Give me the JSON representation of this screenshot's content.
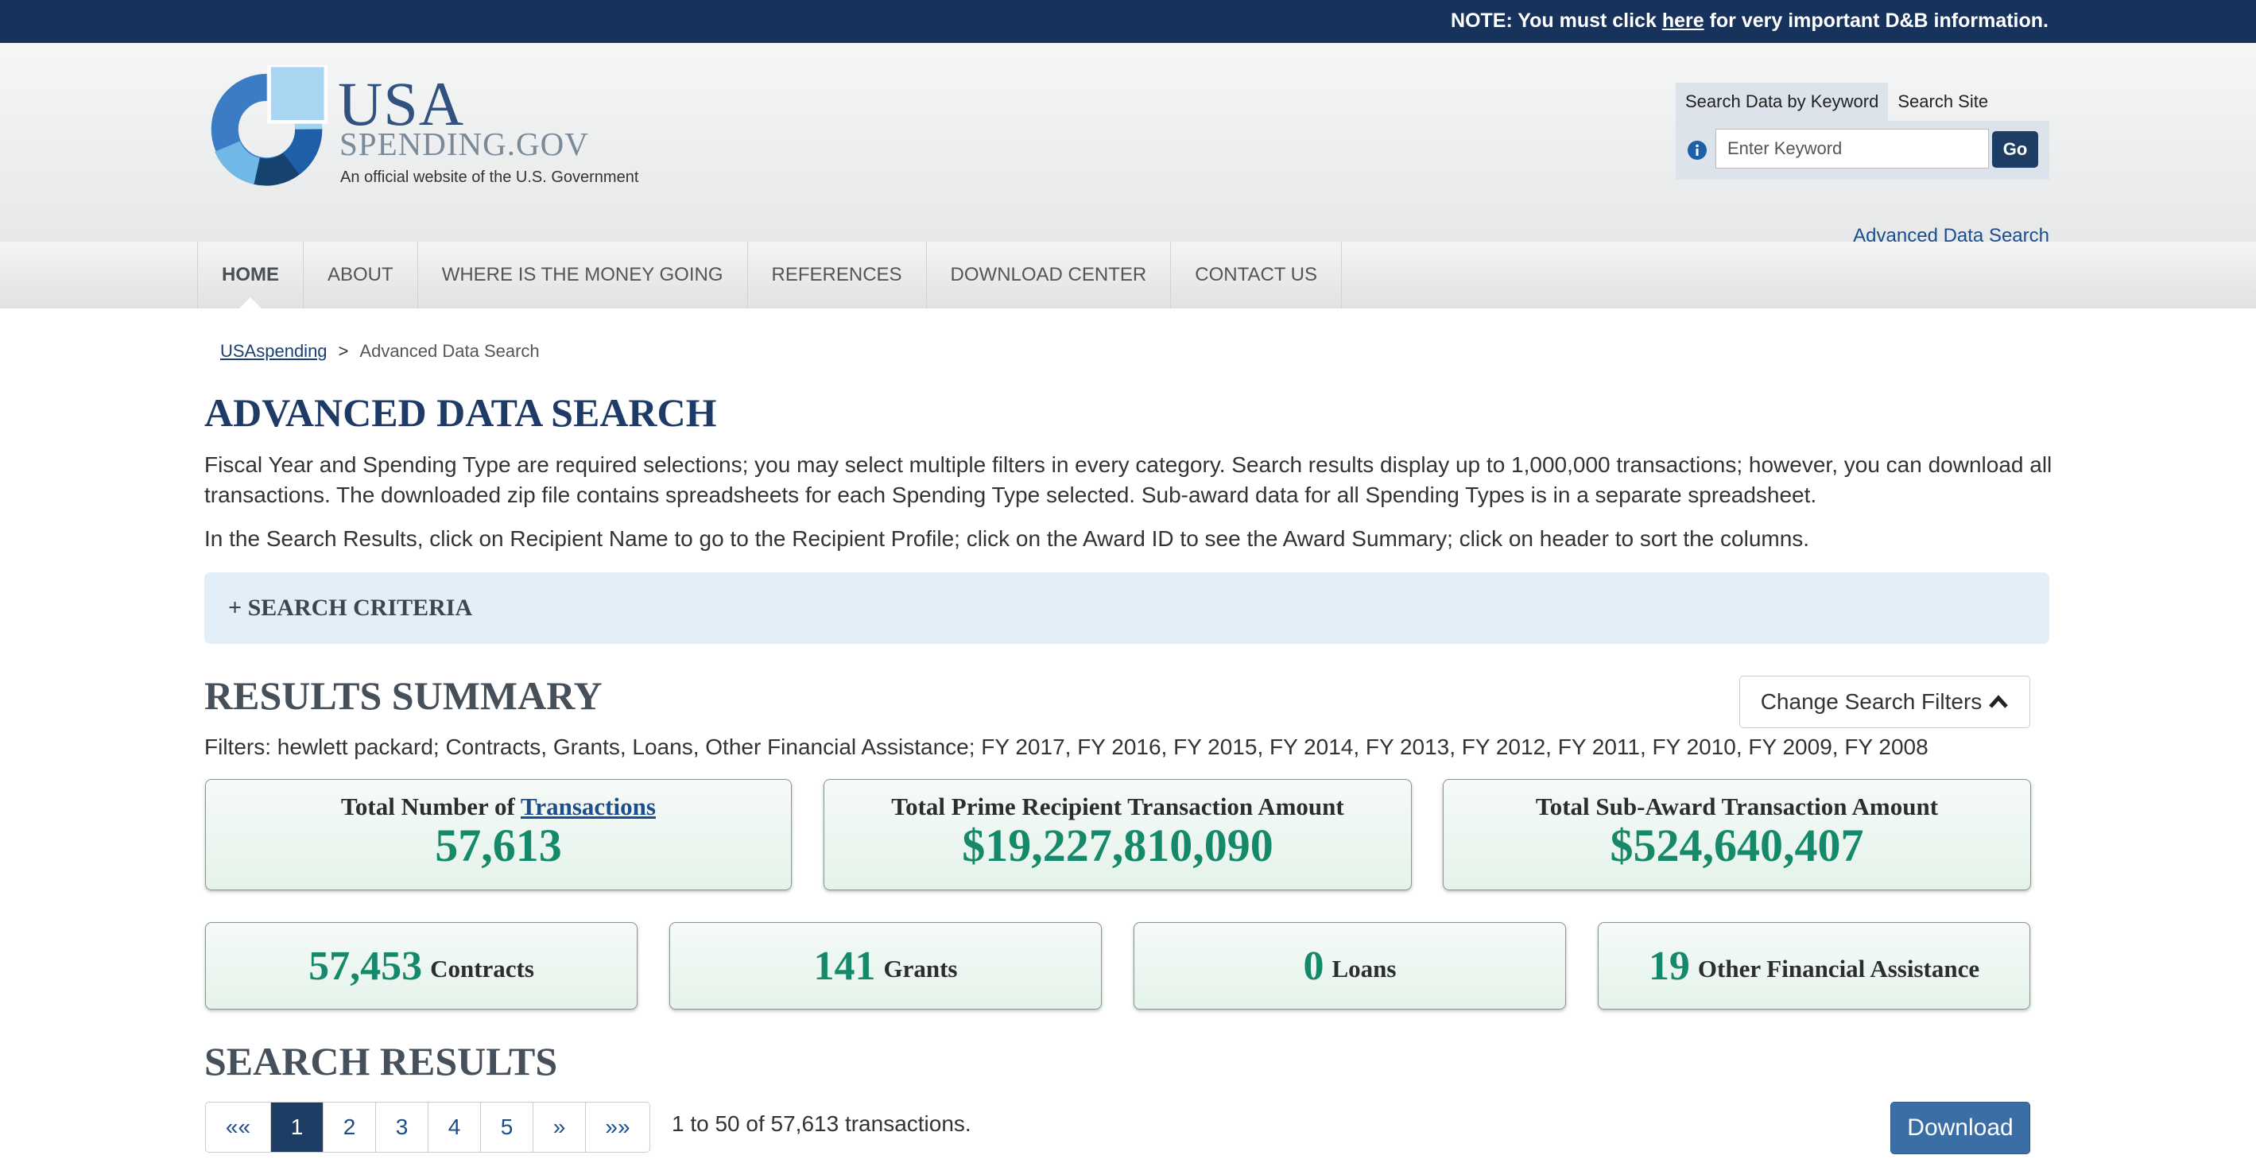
{
  "notice": {
    "prefix": "NOTE: You must click ",
    "link": "here",
    "suffix": " for very important D&B information."
  },
  "logo": {
    "line1": "USA",
    "line2": "SPENDING.GOV",
    "tagline": "An official website of the U.S. Government"
  },
  "search": {
    "tab_keyword": "Search Data by Keyword",
    "tab_site": "Search Site",
    "placeholder": "Enter Keyword",
    "go_label": "Go",
    "advanced_link": "Advanced Data Search"
  },
  "nav": {
    "items": [
      "HOME",
      "ABOUT",
      "WHERE IS THE MONEY GOING",
      "REFERENCES",
      "DOWNLOAD CENTER",
      "CONTACT US"
    ]
  },
  "breadcrumb": {
    "home": "USAspending",
    "separator": ">",
    "current": "Advanced Data Search"
  },
  "page": {
    "title": "ADVANCED DATA SEARCH",
    "intro": "Fiscal Year and Spending Type are required selections; you may select multiple filters in every category. Search results display up to 1,000,000 transactions; however, you can download all transactions. The downloaded zip file contains spreadsheets for each Spending Type selected. Sub-award data for all Spending Types is in a separate spreadsheet.",
    "intro2": "In the Search Results, click on Recipient Name to go to the Recipient Profile; click on the Award ID to see the Award Summary; click on header to sort the columns.",
    "criteria_label": "+ SEARCH CRITERIA"
  },
  "summary": {
    "title": "RESULTS SUMMARY",
    "change_filters": "Change Search Filters",
    "filters": "Filters: hewlett packard; Contracts, Grants, Loans, Other Financial Assistance; FY 2017, FY 2016, FY 2015, FY 2014, FY 2013, FY 2012, FY 2011, FY 2010, FY 2009, FY 2008",
    "total_transactions": {
      "label_prefix": "Total Number of ",
      "label_link": "Transactions",
      "value": "57,613"
    },
    "total_prime": {
      "label": "Total Prime Recipient Transaction Amount",
      "value": "$19,227,810,090"
    },
    "total_subaward": {
      "label": "Total Sub-Award Transaction Amount",
      "value": "$524,640,407"
    },
    "types": [
      {
        "count": "57,453",
        "label": "Contracts"
      },
      {
        "count": "141",
        "label": "Grants"
      },
      {
        "count": "0",
        "label": "Loans"
      },
      {
        "count": "19",
        "label": "Other Financial Assistance"
      }
    ]
  },
  "results": {
    "title": "SEARCH RESULTS",
    "pager": [
      "««",
      "1",
      "2",
      "3",
      "4",
      "5",
      "»",
      "»»"
    ],
    "count_text": "1 to 50 of 57,613 transactions.",
    "download_label": "Download"
  },
  "colors": {
    "navy": "#17335c",
    "accent_green": "#17896b",
    "link_blue": "#1b4e8a"
  }
}
